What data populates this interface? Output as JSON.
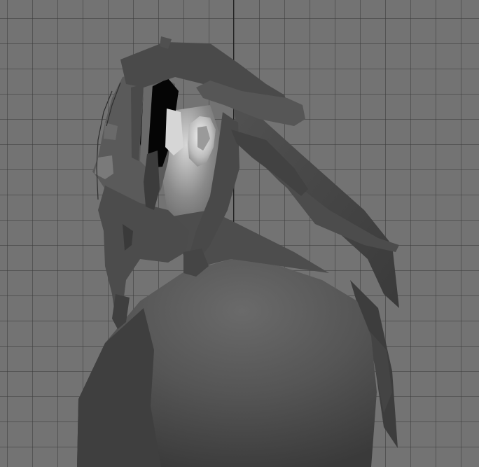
{
  "viewport": {
    "background_color": "#737373",
    "grid_color": "#3a3a3a",
    "axis_color": "#1f1f1f"
  },
  "model": {
    "subject": "character-bust",
    "palette": {
      "skin_dark": "#3e3e3e",
      "skin_mid": "#555555",
      "skin_light": "#6a6a6a",
      "hair": "#4a4a4a",
      "hair_shadow": "#343434",
      "ear_highlight": "#e0e0e0",
      "eye_socket": "#050505"
    }
  }
}
